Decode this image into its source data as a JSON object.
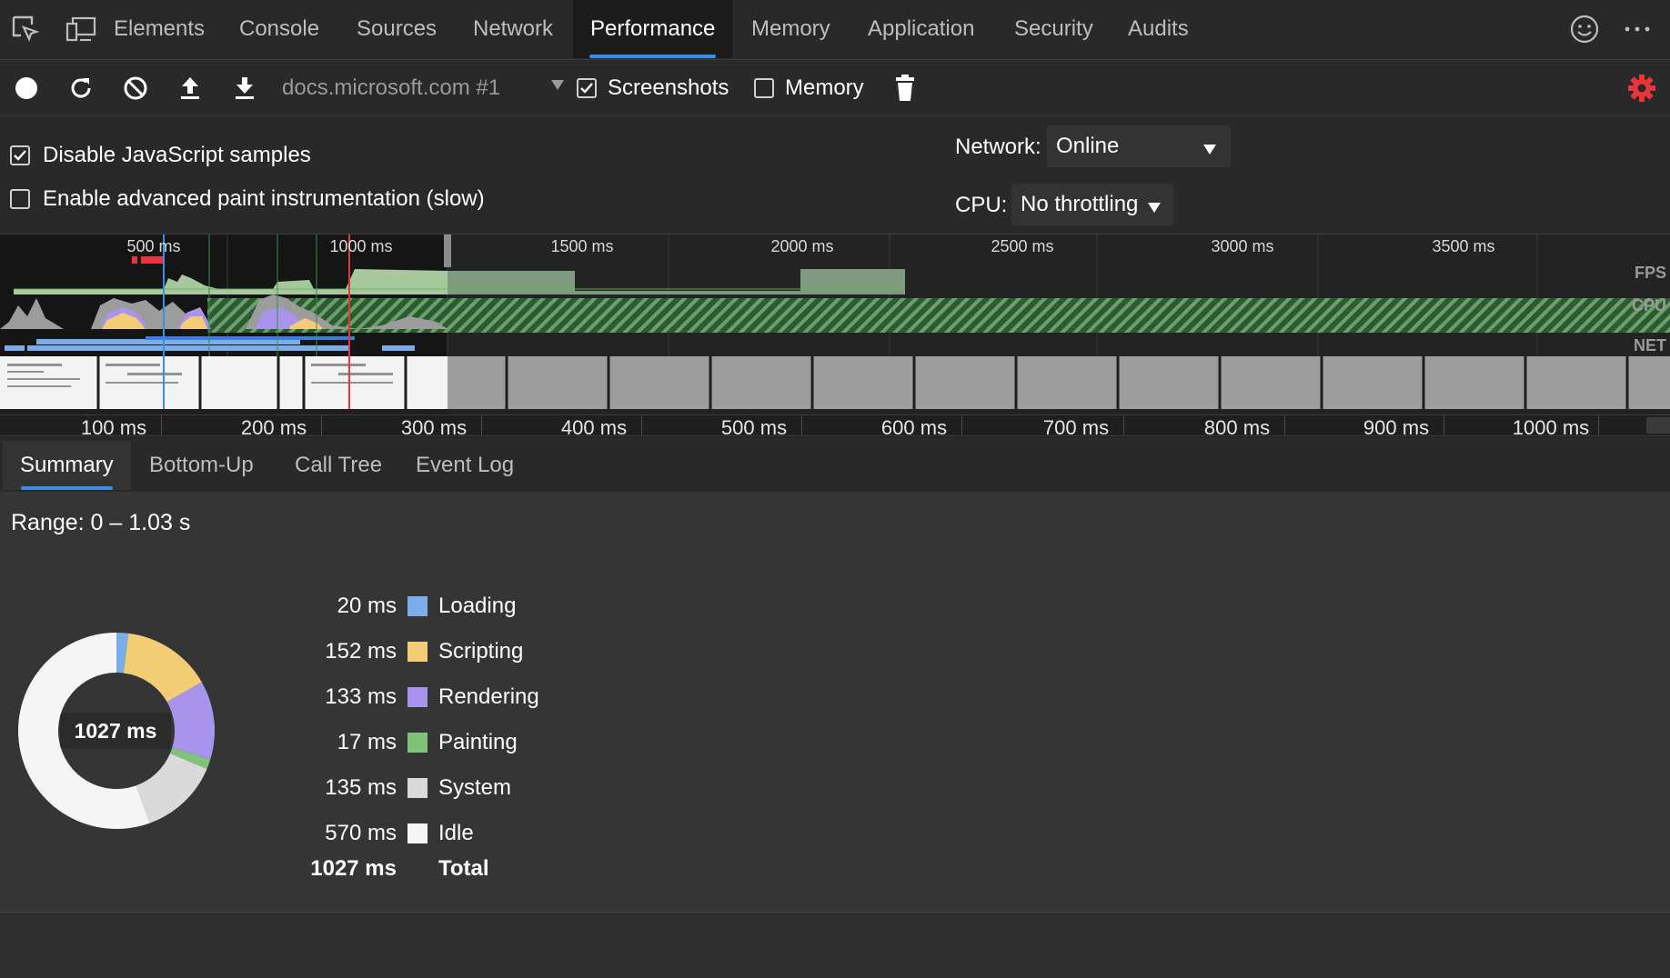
{
  "devtools_tabs": [
    "Elements",
    "Console",
    "Sources",
    "Network",
    "Performance",
    "Memory",
    "Application",
    "Security",
    "Audits"
  ],
  "active_tab": "Performance",
  "toolbar": {
    "profile_select": "docs.microsoft.com #1",
    "screenshots_label": "Screenshots",
    "screenshots_checked": true,
    "memory_label": "Memory",
    "memory_checked": false
  },
  "settings": {
    "disable_js_samples_label": "Disable JavaScript samples",
    "disable_js_samples_checked": true,
    "advanced_paint_label": "Enable advanced paint instrumentation (slow)",
    "advanced_paint_checked": false,
    "network_label": "Network:",
    "network_value": "Online",
    "cpu_label": "CPU:",
    "cpu_value": "No throttling"
  },
  "overview": {
    "ruler_labels": [
      "500 ms",
      "1000 ms",
      "1500 ms",
      "2000 ms",
      "2500 ms",
      "3000 ms",
      "3500 ms"
    ],
    "lane_labels": {
      "fps": "FPS",
      "cpu": "CPU",
      "net": "NET"
    }
  },
  "detail_ruler_labels": [
    "100 ms",
    "200 ms",
    "300 ms",
    "400 ms",
    "500 ms",
    "600 ms",
    "700 ms",
    "800 ms",
    "900 ms",
    "1000 ms"
  ],
  "bottom_tabs": [
    "Summary",
    "Bottom-Up",
    "Call Tree",
    "Event Log"
  ],
  "active_bottom_tab": "Summary",
  "summary": {
    "range": "Range: 0 – 1.03 s",
    "total_center": "1027 ms",
    "items": [
      {
        "value": "20 ms",
        "ms": 20,
        "label": "Loading",
        "color": "#7baee8"
      },
      {
        "value": "152 ms",
        "ms": 152,
        "label": "Scripting",
        "color": "#f2cd75"
      },
      {
        "value": "133 ms",
        "ms": 133,
        "label": "Rendering",
        "color": "#a894ec"
      },
      {
        "value": "17 ms",
        "ms": 17,
        "label": "Painting",
        "color": "#80c27a"
      },
      {
        "value": "135 ms",
        "ms": 135,
        "label": "System",
        "color": "#dadada"
      },
      {
        "value": "570 ms",
        "ms": 570,
        "label": "Idle",
        "color": "#f5f5f5"
      }
    ],
    "total_value": "1027 ms",
    "total_label": "Total"
  },
  "colors": {
    "accent": "#3a8ee6",
    "settings_gear": "#e8353b",
    "record_marker": "#e8353b"
  }
}
